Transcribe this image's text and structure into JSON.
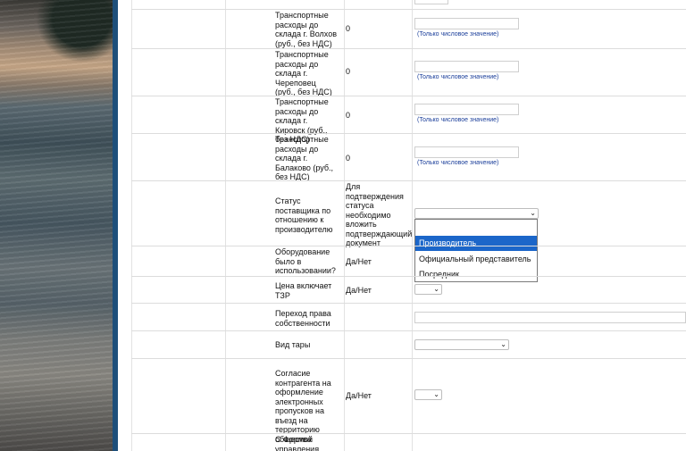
{
  "hint_text": "(Только числовое значение)",
  "rows": [
    {
      "label": "Транспортные расходы до склада г. Волхов (руб., без НДС)",
      "value": "0"
    },
    {
      "label": "Транспортные расходы до склада г. Череповец (руб., без НДС)",
      "value": "0"
    },
    {
      "label": "Транспортные расходы до склада г. Кировск (руб., без НДС)",
      "value": "0"
    },
    {
      "label": "Транспортные расходы до склада г. Балаково (руб., без НДС)",
      "value": "0"
    },
    {
      "label": "Статус поставщика по отношению к производителю",
      "value": "Для подтверждения статуса необходимо вложить подтверждающий документ"
    },
    {
      "label": "Оборудование было в использовании?",
      "value": "Да/Нет"
    },
    {
      "label": "Цена включает ТЗР",
      "value": "Да/Нет"
    },
    {
      "label": "Переход права собственности",
      "value": ""
    },
    {
      "label": "Вид тары",
      "value": ""
    },
    {
      "label": "Согласие контрагента на оформление электронных пропусков на въезд на территорию общества",
      "value": "Да/Нет"
    },
    {
      "label": "С Формой управления",
      "value": ""
    }
  ],
  "supplier_status_options": [
    "",
    "Производитель",
    "Официальный представитель",
    "Посредник"
  ],
  "highlighted_option": "Производитель",
  "colors": {
    "accent": "#1b66c9",
    "hint": "#1a3e9a",
    "sidebar_bar": "#1e4f7a"
  },
  "icons": {
    "select_arrow": "chevron-down-icon"
  }
}
